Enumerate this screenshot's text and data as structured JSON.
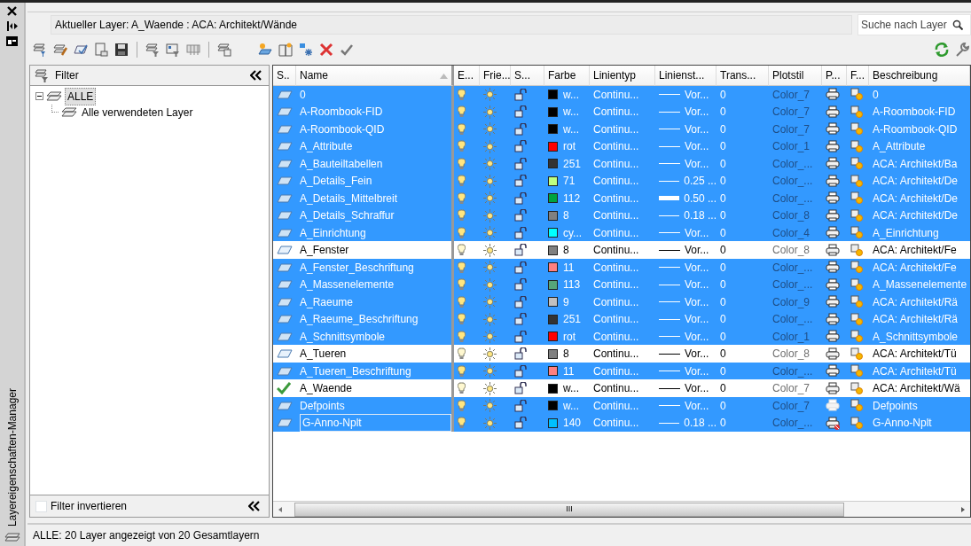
{
  "side_panel": {
    "title": "Layereigenschaften-Manager"
  },
  "current_layer": "Aktueller Layer: A_Waende : ACA:  Architekt/Wände",
  "search": {
    "placeholder": "Suche nach Layer"
  },
  "filter_panel": {
    "heading": "Filter",
    "tree": [
      {
        "label": "ALLE",
        "selected": true,
        "children": [
          {
            "label": "Alle verwendeten Layer",
            "selected": false
          }
        ]
      }
    ],
    "invert_label": "Filter invertieren",
    "invert_checked": false
  },
  "table": {
    "columns": [
      "S..",
      "Name",
      "E...",
      "Frie...",
      "S...",
      "Farbe",
      "Linientyp",
      "Linienst...",
      "Trans...",
      "Plotstil",
      "P...",
      "F...",
      "Beschreibung"
    ],
    "rows": [
      {
        "name": "0",
        "selected": true,
        "current": false,
        "focused": false,
        "color": "#000000",
        "color_label": "w...",
        "linetype": "Continu...",
        "lineweight": "Vor...",
        "heavy": false,
        "transparency": "0",
        "plotstyle": "Color_7",
        "plot": true,
        "plot_greyed": false,
        "description": "0"
      },
      {
        "name": "A-Roombook-FID",
        "selected": true,
        "current": false,
        "focused": false,
        "color": "#000000",
        "color_label": "w...",
        "linetype": "Continu...",
        "lineweight": "Vor...",
        "heavy": false,
        "transparency": "0",
        "plotstyle": "Color_7",
        "plot": true,
        "plot_greyed": false,
        "description": "A-Roombook-FID"
      },
      {
        "name": "A-Roombook-QID",
        "selected": true,
        "current": false,
        "focused": false,
        "color": "#000000",
        "color_label": "w...",
        "linetype": "Continu...",
        "lineweight": "Vor...",
        "heavy": false,
        "transparency": "0",
        "plotstyle": "Color_7",
        "plot": true,
        "plot_greyed": false,
        "description": "A-Roombook-QID"
      },
      {
        "name": "A_Attribute",
        "selected": true,
        "current": false,
        "focused": false,
        "color": "#ff0000",
        "color_label": "rot",
        "linetype": "Continu...",
        "lineweight": "Vor...",
        "heavy": false,
        "transparency": "0",
        "plotstyle": "Color_1",
        "plot": true,
        "plot_greyed": false,
        "description": "A_Attribute"
      },
      {
        "name": "A_Bauteiltabellen",
        "selected": true,
        "current": false,
        "focused": false,
        "color": "#333333",
        "color_label": "251",
        "linetype": "Continu...",
        "lineweight": "Vor...",
        "heavy": false,
        "transparency": "0",
        "plotstyle": "Color_...",
        "plot": true,
        "plot_greyed": false,
        "description": "ACA:  Architekt/Ba"
      },
      {
        "name": "A_Details_Fein",
        "selected": true,
        "current": false,
        "focused": false,
        "color": "#bfff80",
        "color_label": "71",
        "linetype": "Continu...",
        "lineweight": "0.25 ...",
        "heavy": false,
        "transparency": "0",
        "plotstyle": "Color_...",
        "plot": true,
        "plot_greyed": false,
        "description": "ACA:  Architekt/De"
      },
      {
        "name": "A_Details_Mittelbreit",
        "selected": true,
        "current": false,
        "focused": false,
        "color": "#00a33f",
        "color_label": "112",
        "linetype": "Continu...",
        "lineweight": "0.50 ...",
        "heavy": true,
        "transparency": "0",
        "plotstyle": "Color_...",
        "plot": true,
        "plot_greyed": false,
        "description": "ACA:  Architekt/De"
      },
      {
        "name": "A_Details_Schraffur",
        "selected": true,
        "current": false,
        "focused": false,
        "color": "#808080",
        "color_label": "8",
        "linetype": "Continu...",
        "lineweight": "0.18 ...",
        "heavy": false,
        "transparency": "0",
        "plotstyle": "Color_8",
        "plot": true,
        "plot_greyed": false,
        "description": "ACA:  Architekt/De"
      },
      {
        "name": "A_Einrichtung",
        "selected": true,
        "current": false,
        "focused": false,
        "color": "#00ffff",
        "color_label": "cy...",
        "linetype": "Continu...",
        "lineweight": "Vor...",
        "heavy": false,
        "transparency": "0",
        "plotstyle": "Color_4",
        "plot": true,
        "plot_greyed": false,
        "description": "A_Einrichtung"
      },
      {
        "name": "A_Fenster",
        "selected": false,
        "current": false,
        "focused": false,
        "color": "#808080",
        "color_label": "8",
        "linetype": "Continu...",
        "lineweight": "Vor...",
        "heavy": false,
        "transparency": "0",
        "plotstyle": "Color_8",
        "plot": true,
        "plot_greyed": false,
        "description": "ACA:  Architekt/Fe"
      },
      {
        "name": "A_Fenster_Beschriftung",
        "selected": true,
        "current": false,
        "focused": false,
        "color": "#ff8080",
        "color_label": "11",
        "linetype": "Continu...",
        "lineweight": "Vor...",
        "heavy": false,
        "transparency": "0",
        "plotstyle": "Color_...",
        "plot": true,
        "plot_greyed": false,
        "description": "ACA:  Architekt/Fe"
      },
      {
        "name": "A_Massenelemente",
        "selected": true,
        "current": false,
        "focused": false,
        "color": "#56a57a",
        "color_label": "113",
        "linetype": "Continu...",
        "lineweight": "Vor...",
        "heavy": false,
        "transparency": "0",
        "plotstyle": "Color_...",
        "plot": true,
        "plot_greyed": false,
        "description": "A_Massenelemente"
      },
      {
        "name": "A_Raeume",
        "selected": true,
        "current": false,
        "focused": false,
        "color": "#c0c0c0",
        "color_label": "9",
        "linetype": "Continu...",
        "lineweight": "Vor...",
        "heavy": false,
        "transparency": "0",
        "plotstyle": "Color_9",
        "plot": true,
        "plot_greyed": false,
        "description": "ACA:  Architekt/Rä"
      },
      {
        "name": "A_Raeume_Beschriftung",
        "selected": true,
        "current": false,
        "focused": false,
        "color": "#333333",
        "color_label": "251",
        "linetype": "Continu...",
        "lineweight": "Vor...",
        "heavy": false,
        "transparency": "0",
        "plotstyle": "Color_...",
        "plot": true,
        "plot_greyed": false,
        "description": "ACA:  Architekt/Rä"
      },
      {
        "name": "A_Schnittsymbole",
        "selected": true,
        "current": false,
        "focused": false,
        "color": "#ff0000",
        "color_label": "rot",
        "linetype": "Continu...",
        "lineweight": "Vor...",
        "heavy": false,
        "transparency": "0",
        "plotstyle": "Color_1",
        "plot": true,
        "plot_greyed": false,
        "description": "A_Schnittsymbole"
      },
      {
        "name": "A_Tueren",
        "selected": false,
        "current": false,
        "focused": false,
        "color": "#808080",
        "color_label": "8",
        "linetype": "Continu...",
        "lineweight": "Vor...",
        "heavy": false,
        "transparency": "0",
        "plotstyle": "Color_8",
        "plot": true,
        "plot_greyed": false,
        "description": "ACA:  Architekt/Tü"
      },
      {
        "name": "A_Tueren_Beschriftung",
        "selected": true,
        "current": false,
        "focused": false,
        "color": "#ff8080",
        "color_label": "11",
        "linetype": "Continu...",
        "lineweight": "Vor...",
        "heavy": false,
        "transparency": "0",
        "plotstyle": "Color_...",
        "plot": true,
        "plot_greyed": false,
        "description": "ACA:  Architekt/Tü"
      },
      {
        "name": "A_Waende",
        "selected": false,
        "current": true,
        "focused": false,
        "color": "#000000",
        "color_label": "w...",
        "linetype": "Continu...",
        "lineweight": "Vor...",
        "heavy": false,
        "transparency": "0",
        "plotstyle": "Color_7",
        "plot": true,
        "plot_greyed": false,
        "description": "ACA:  Architekt/Wä"
      },
      {
        "name": "Defpoints",
        "selected": true,
        "current": false,
        "focused": false,
        "color": "#000000",
        "color_label": "w...",
        "linetype": "Continu...",
        "lineweight": "Vor...",
        "heavy": false,
        "transparency": "0",
        "plotstyle": "Color_7",
        "plot": true,
        "plot_greyed": true,
        "description": "Defpoints"
      },
      {
        "name": "G-Anno-Nplt",
        "selected": true,
        "current": false,
        "focused": true,
        "color": "#00bfff",
        "color_label": "140",
        "linetype": "Continu...",
        "lineweight": "0.18 ...",
        "heavy": false,
        "transparency": "0",
        "plotstyle": "Color_...",
        "plot": false,
        "plot_greyed": false,
        "description": "G-Anno-Nplt"
      }
    ]
  },
  "scrollbar_grip": "III",
  "status_bar": "ALLE: 20 Layer angezeigt von 20 Gesamtlayern"
}
